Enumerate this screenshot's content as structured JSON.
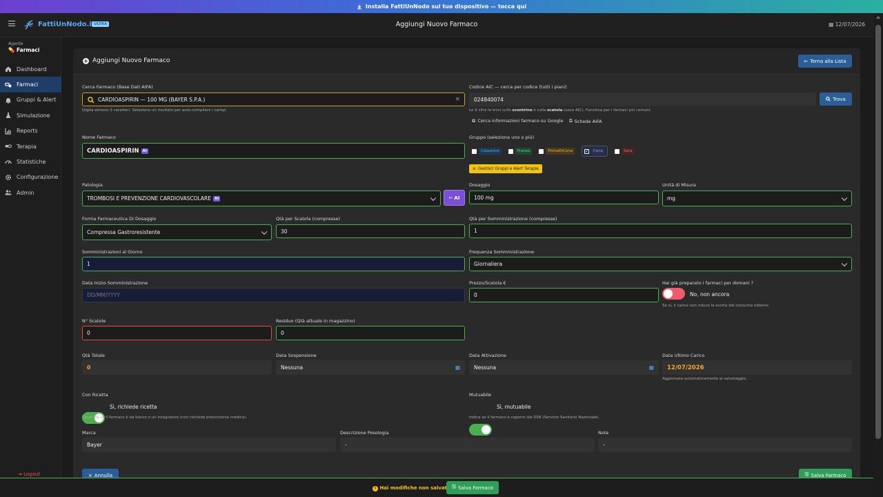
{
  "banner": {
    "text": "Installa FattiUnNodo sul tuo dispositivo — tocca qui"
  },
  "header": {
    "logo": "FattiUnNodo.it",
    "badge": "ULTRA",
    "title": "Aggiungi Nuovo Farmaco",
    "date": "12/07/2026"
  },
  "sidebar": {
    "agent_label": "Agente",
    "agent_value": "Farmaci",
    "items": [
      {
        "label": "Dashboard",
        "icon": "home-icon"
      },
      {
        "label": "Farmaci",
        "icon": "pills-icon",
        "active": true
      },
      {
        "label": "Gruppi & Alert",
        "icon": "bell-icon"
      },
      {
        "label": "Simulazione",
        "icon": "flask-icon"
      },
      {
        "label": "Reports",
        "icon": "chart-icon"
      },
      {
        "label": "Terapia",
        "icon": "capsules-icon"
      },
      {
        "label": "Statistiche",
        "icon": "gauge-icon"
      },
      {
        "label": "Configurazione",
        "icon": "gear-icon"
      },
      {
        "label": "Admin",
        "icon": "users-icon"
      }
    ],
    "logout": "Logout"
  },
  "card": {
    "title": "Aggiungi Nuovo Farmaco",
    "back": "Torna alla Lista"
  },
  "form": {
    "search": {
      "label": "Cerca Farmaco (Base Dati AIFA)",
      "value": "CARDIOASPIRIN — 100 MG (BAYER S.P.A.)",
      "help": "Digita almeno 3 caratteri. Seleziona un risultato per auto-compilare i campi."
    },
    "aic": {
      "label": "Codice AIC — cerca per codice (tutti i piani)",
      "value": "024840074",
      "button": "Trova",
      "help_pre": "Le 9 cifre le trovi sullo ",
      "help_b1": "scontrino",
      "help_mid": " o sulla ",
      "help_b2": "scatola",
      "help_post": " (voce AIC). Funziona per i farmaci più comuni.",
      "google": "Cerca informazioni farmaco su Google",
      "aifa": "Schede AIFA"
    },
    "nome": {
      "label": "Nome Farmaco",
      "value": "CARDIOASPIRIN",
      "ai": "AI"
    },
    "gruppo": {
      "label": "Gruppo (seleziona uno o più)",
      "options": [
        {
          "label": "Colazione",
          "checked": false,
          "color": "#5dade2",
          "bg": "#1e3a52"
        },
        {
          "label": "Pranzo",
          "checked": false,
          "color": "#58d68d",
          "bg": "#1e4a30"
        },
        {
          "label": "PrimaDiCena",
          "checked": false,
          "color": "#f5b041",
          "bg": "#4a3a1c"
        },
        {
          "label": "Cena",
          "checked": true,
          "color": "#8e9bd8",
          "bg": "#2a3050"
        },
        {
          "label": "Sera",
          "checked": false,
          "color": "#ec7063",
          "bg": "#4a2424"
        }
      ],
      "manage": "Gestisci Gruppi e Alert Terapie"
    },
    "patologia": {
      "label": "Patologia",
      "value": "TROMBOSI E PREVENZIONE CARDIOVASCOLARE",
      "ai": "AI",
      "btn": "AI"
    },
    "dosaggio": {
      "label": "Dosaggio",
      "value": "100 mg"
    },
    "unita": {
      "label": "Unità di Misura",
      "value": "mg"
    },
    "forma": {
      "label": "Forma Farmaceutica Di Dosaggio",
      "value": "Compressa Gastroresistente"
    },
    "qta_scatola": {
      "label": "Qtà per Scatola (compresse)",
      "value": "30"
    },
    "qta_somm": {
      "label": "Qtà per Somministrazione (compresse)",
      "value": "1"
    },
    "somm_giorno": {
      "label": "Somministrazioni al Giorno",
      "value": "1"
    },
    "frequenza": {
      "label": "Frequenza Somministrazione",
      "value": "Giornaliera"
    },
    "data_inizio": {
      "label": "Data Inizio Somministrazione",
      "placeholder": "DD/MM/YYYY"
    },
    "prezzo": {
      "label": "Prezzo/Scatola €",
      "value": "0"
    },
    "preparato": {
      "label": "Hai già preparato i farmaci per domani ?",
      "value": "No, non ancora",
      "help": "Se sì, il carico non riduce la scorta del consumo odierno."
    },
    "n_scatole": {
      "label": "N° Scatole",
      "value": "0"
    },
    "residuo": {
      "label": "Residuo (Qtà attuale in magazzino)",
      "value": "0"
    },
    "qta_totale": {
      "label": "Qtà Totale",
      "value": "0"
    },
    "sospensione": {
      "label": "Data Sospensione",
      "value": "Nessuna"
    },
    "attivazione": {
      "label": "Data Attivazione",
      "value": "Nessuna"
    },
    "ultimo_carico": {
      "label": "Data Ultimo Carico",
      "value": "12/07/2026",
      "help": "Aggiornata automaticamente al salvataggio."
    },
    "ricetta": {
      "label": "Con Ricetta",
      "value": "Sì, richiede ricetta",
      "help": "Disattiva se il farmaco è da banco o un integratore (non richiede prescrizione medica)."
    },
    "mutuabile": {
      "label": "Mutuabile",
      "value": "Sì, mutuabile",
      "help": "Indica se il farmaco è coperto dal SSN (Servizio Sanitario Nazionale)."
    },
    "marca": {
      "label": "Marca",
      "value": "Bayer"
    },
    "descrizione": {
      "label": "Descrizione Posologia",
      "value": "-"
    },
    "note": {
      "label": "Note",
      "value": "-"
    }
  },
  "actions": {
    "annulla": "Annulla",
    "salva": "Salva Farmaco"
  },
  "footer": {
    "unsaved": "Hai modifiche non salvate",
    "salva": "Salva Farmaco"
  },
  "colors": {
    "accent": "#2b5d96",
    "success": "#4caf50",
    "danger": "#e74c3c",
    "toggle_off": "#ef5b6b"
  }
}
